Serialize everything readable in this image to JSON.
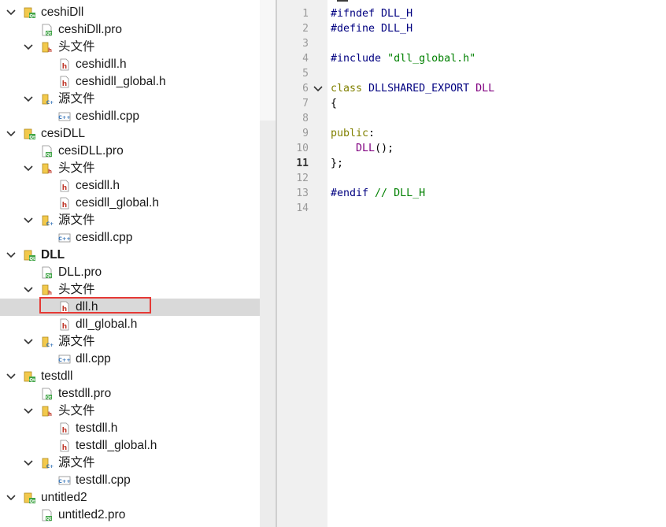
{
  "tree": {
    "rows": [
      {
        "depth": 0,
        "arrow": "expanded",
        "icon": "project",
        "label": "ceshiDll",
        "bold": false
      },
      {
        "depth": 1,
        "arrow": "none",
        "icon": "pro",
        "label": "ceshiDll.pro",
        "bold": false
      },
      {
        "depth": 1,
        "arrow": "expanded",
        "icon": "folder-h",
        "label": "头文件",
        "bold": false
      },
      {
        "depth": 2,
        "arrow": "none",
        "icon": "header",
        "label": "ceshidll.h",
        "bold": false
      },
      {
        "depth": 2,
        "arrow": "none",
        "icon": "header",
        "label": "ceshidll_global.h",
        "bold": false
      },
      {
        "depth": 1,
        "arrow": "expanded",
        "icon": "folder-cpp",
        "label": "源文件",
        "bold": false
      },
      {
        "depth": 2,
        "arrow": "none",
        "icon": "cpp",
        "label": "ceshidll.cpp",
        "bold": false
      },
      {
        "depth": 0,
        "arrow": "expanded",
        "icon": "project",
        "label": "cesiDLL",
        "bold": false
      },
      {
        "depth": 1,
        "arrow": "none",
        "icon": "pro",
        "label": "cesiDLL.pro",
        "bold": false
      },
      {
        "depth": 1,
        "arrow": "expanded",
        "icon": "folder-h",
        "label": "头文件",
        "bold": false
      },
      {
        "depth": 2,
        "arrow": "none",
        "icon": "header",
        "label": "cesidll.h",
        "bold": false
      },
      {
        "depth": 2,
        "arrow": "none",
        "icon": "header",
        "label": "cesidll_global.h",
        "bold": false
      },
      {
        "depth": 1,
        "arrow": "expanded",
        "icon": "folder-cpp",
        "label": "源文件",
        "bold": false
      },
      {
        "depth": 2,
        "arrow": "none",
        "icon": "cpp",
        "label": "cesidll.cpp",
        "bold": false
      },
      {
        "depth": 0,
        "arrow": "expanded",
        "icon": "project",
        "label": "DLL",
        "bold": true
      },
      {
        "depth": 1,
        "arrow": "none",
        "icon": "pro",
        "label": "DLL.pro",
        "bold": false
      },
      {
        "depth": 1,
        "arrow": "expanded",
        "icon": "folder-h",
        "label": "头文件",
        "bold": false
      },
      {
        "depth": 2,
        "arrow": "none",
        "icon": "header",
        "label": "dll.h",
        "bold": false,
        "selected": true
      },
      {
        "depth": 2,
        "arrow": "none",
        "icon": "header",
        "label": "dll_global.h",
        "bold": false
      },
      {
        "depth": 1,
        "arrow": "expanded",
        "icon": "folder-cpp",
        "label": "源文件",
        "bold": false
      },
      {
        "depth": 2,
        "arrow": "none",
        "icon": "cpp",
        "label": "dll.cpp",
        "bold": false
      },
      {
        "depth": 0,
        "arrow": "expanded",
        "icon": "project",
        "label": "testdll",
        "bold": false
      },
      {
        "depth": 1,
        "arrow": "none",
        "icon": "pro",
        "label": "testdll.pro",
        "bold": false
      },
      {
        "depth": 1,
        "arrow": "expanded",
        "icon": "folder-h",
        "label": "头文件",
        "bold": false
      },
      {
        "depth": 2,
        "arrow": "none",
        "icon": "header",
        "label": "testdll.h",
        "bold": false
      },
      {
        "depth": 2,
        "arrow": "none",
        "icon": "header",
        "label": "testdll_global.h",
        "bold": false
      },
      {
        "depth": 1,
        "arrow": "expanded",
        "icon": "folder-cpp",
        "label": "源文件",
        "bold": false
      },
      {
        "depth": 2,
        "arrow": "none",
        "icon": "cpp",
        "label": "testdll.cpp",
        "bold": false
      },
      {
        "depth": 0,
        "arrow": "expanded",
        "icon": "project",
        "label": "untitled2",
        "bold": false
      },
      {
        "depth": 1,
        "arrow": "none",
        "icon": "pro",
        "label": "untitled2.pro",
        "bold": false
      }
    ]
  },
  "editor": {
    "current_line": 11,
    "fold_line": 6,
    "lines": [
      {
        "n": "1",
        "tokens": [
          {
            "t": "#ifndef DLL_H",
            "c": "pre"
          }
        ]
      },
      {
        "n": "2",
        "tokens": [
          {
            "t": "#define DLL_H",
            "c": "pre"
          }
        ]
      },
      {
        "n": "3",
        "tokens": []
      },
      {
        "n": "4",
        "tokens": [
          {
            "t": "#include ",
            "c": "pre"
          },
          {
            "t": "\"dll_global.h\"",
            "c": "str"
          }
        ]
      },
      {
        "n": "5",
        "tokens": []
      },
      {
        "n": "6",
        "tokens": [
          {
            "t": "class ",
            "c": "kw"
          },
          {
            "t": "DLLSHARED_EXPORT ",
            "c": "pre"
          },
          {
            "t": "DLL",
            "c": "mac"
          }
        ]
      },
      {
        "n": "7",
        "tokens": [
          {
            "t": "{",
            "c": "txt"
          }
        ]
      },
      {
        "n": "8",
        "tokens": []
      },
      {
        "n": "9",
        "tokens": [
          {
            "t": "public",
            "c": "kw"
          },
          {
            "t": ":",
            "c": "txt"
          }
        ]
      },
      {
        "n": "10",
        "tokens": [
          {
            "t": "    ",
            "c": "txt"
          },
          {
            "t": "DLL",
            "c": "mac"
          },
          {
            "t": "();",
            "c": "txt"
          }
        ]
      },
      {
        "n": "11",
        "tokens": [
          {
            "t": "};",
            "c": "txt"
          }
        ]
      },
      {
        "n": "12",
        "tokens": []
      },
      {
        "n": "13",
        "tokens": [
          {
            "t": "#endif ",
            "c": "pre"
          },
          {
            "t": "// DLL_H",
            "c": "cmt"
          }
        ]
      },
      {
        "n": "14",
        "tokens": []
      }
    ]
  },
  "colors": {
    "selection_highlight": "#d9d9d9",
    "annotation_box": "#e53935",
    "gutter_bg": "#f0f0f0"
  }
}
